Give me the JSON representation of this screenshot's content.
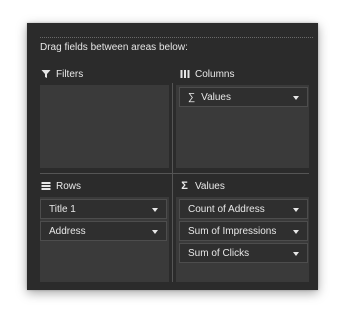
{
  "hint": "Drag fields between areas below:",
  "areas": {
    "filters": {
      "label": "Filters",
      "icon": "filter-icon",
      "fields": []
    },
    "columns": {
      "label": "Columns",
      "icon": "columns-icon",
      "fields": [
        {
          "label": "Values",
          "prefix": "∑"
        }
      ]
    },
    "rows": {
      "label": "Rows",
      "icon": "rows-icon",
      "fields": [
        {
          "label": "Title 1"
        },
        {
          "label": "Address"
        }
      ]
    },
    "values": {
      "label": "Values",
      "icon": "sigma-icon",
      "prefix": "Σ",
      "fields": [
        {
          "label": "Count of Address"
        },
        {
          "label": "Sum of Impressions"
        },
        {
          "label": "Sum of Clicks"
        }
      ]
    }
  },
  "colors": {
    "panel_bg": "#2b2b2b",
    "zone_bg": "#3a3a3a",
    "text": "#e6e6e6"
  }
}
